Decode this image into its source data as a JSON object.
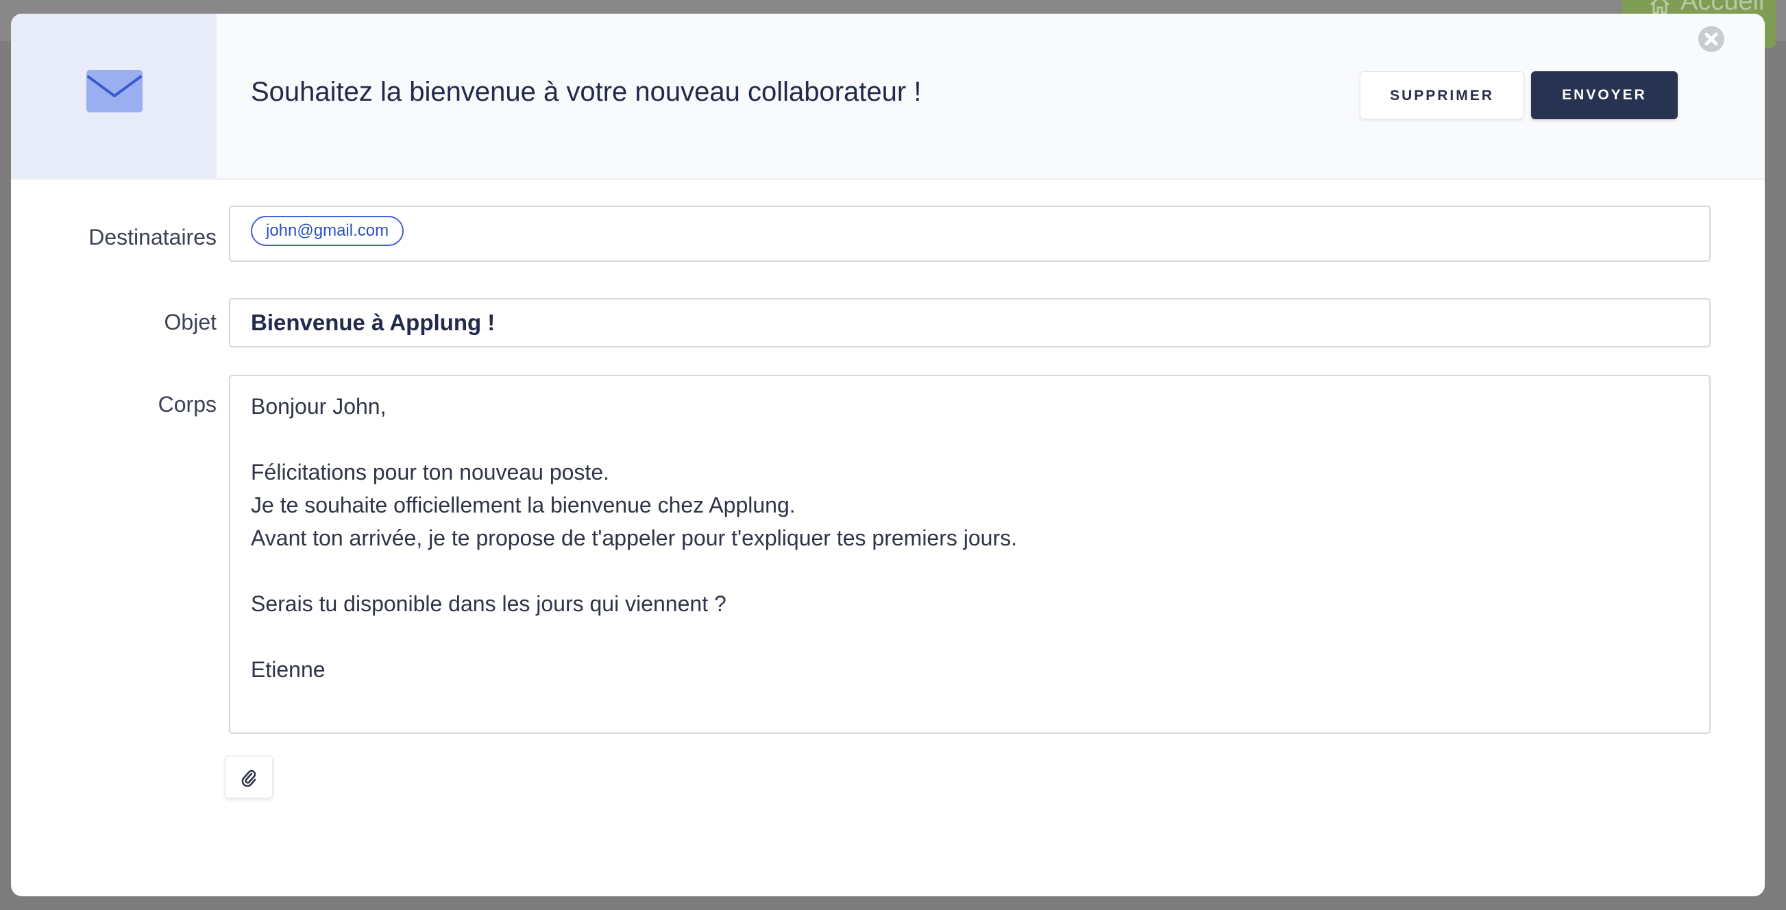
{
  "background": {
    "home_button_label": "Accueil",
    "home_icon": "home-icon"
  },
  "modal": {
    "header_icon": "envelope-icon",
    "title": "Souhaitez la bienvenue à votre nouveau collaborateur !",
    "delete_label": "SUPPRIMER",
    "send_label": "ENVOYER",
    "close_icon": "close-icon"
  },
  "form": {
    "recipients_label": "Destinataires",
    "recipients": [
      "john@gmail.com"
    ],
    "subject_label": "Objet",
    "subject_value": "Bienvenue à Applung !",
    "body_label": "Corps",
    "body_value": "Bonjour John,\n\nFélicitations pour ton nouveau poste.\nJe te souhaite officiellement la bienvenue chez Applung.\nAvant ton arrivée, je te propose de t'appeler pour t'expliquer tes premiers jours.\n\nSerais tu disponible dans les jours qui viennent ?\n\nEtienne",
    "attach_icon": "paperclip-icon"
  },
  "colors": {
    "accent_dark": "#283351",
    "chip_blue": "#3f63d6",
    "header_bg": "#f9fafc",
    "icon_panel_bg": "#e8ecfa",
    "home_button_green": "#7f9d55"
  }
}
